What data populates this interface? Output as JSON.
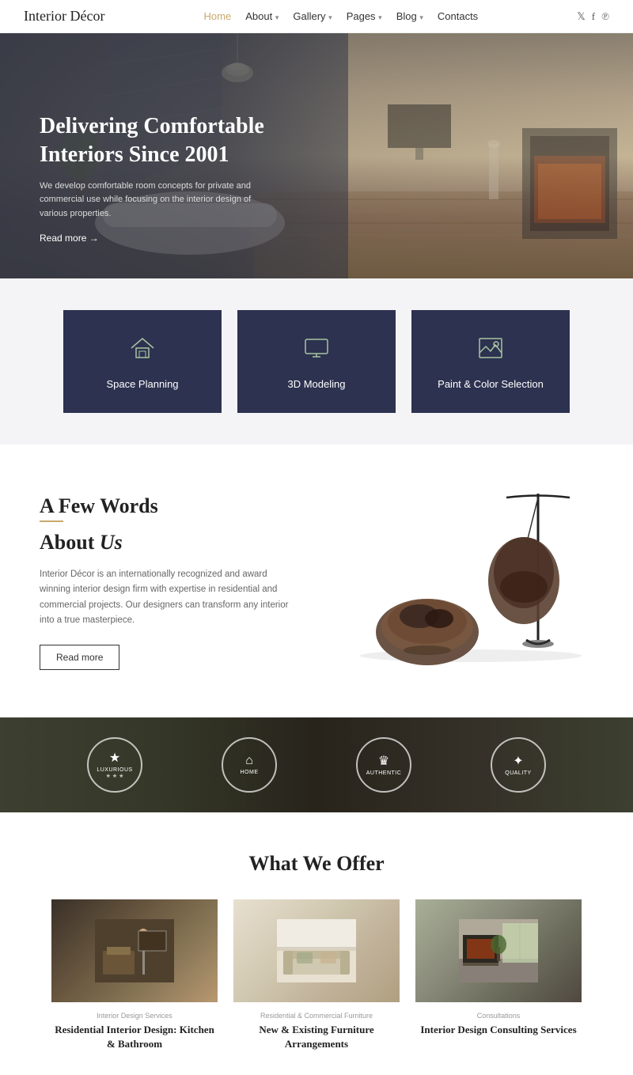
{
  "brand": {
    "name": "Interior Décor"
  },
  "nav": {
    "links": [
      {
        "label": "Home",
        "active": true
      },
      {
        "label": "About",
        "dropdown": true
      },
      {
        "label": "Gallery",
        "dropdown": true
      },
      {
        "label": "Pages",
        "dropdown": true
      },
      {
        "label": "Blog",
        "dropdown": true
      },
      {
        "label": "Contacts",
        "dropdown": false
      }
    ],
    "social": [
      "twitter",
      "facebook",
      "pinterest"
    ]
  },
  "hero": {
    "title": "Delivering Comfortable Interiors Since 2001",
    "description": "We develop comfortable room concepts for private and commercial use while focusing on the interior design of various properties.",
    "cta": "Read more"
  },
  "services": [
    {
      "label": "Space Planning",
      "icon": "🏠"
    },
    {
      "label": "3D Modeling",
      "icon": "🖥"
    },
    {
      "label": "Paint & Color Selection",
      "icon": "🖼"
    }
  ],
  "about": {
    "title_line1": "A Few Words",
    "title_line2": "About",
    "title_italic": "Us",
    "description": "Interior Décor is an internationally recognized and award winning interior design firm with expertise in residential and commercial projects. Our designers can transform any interior into a true masterpiece.",
    "cta": "Read more"
  },
  "badges": [
    {
      "icon": "★",
      "text": "Luxurious",
      "sub": "★ ★ ★"
    },
    {
      "icon": "⌂",
      "text": "Home"
    },
    {
      "icon": "♛",
      "text": "Authentic"
    },
    {
      "icon": "✦",
      "text": "Quality"
    }
  ],
  "offer": {
    "title": "What We Offer",
    "cards": [
      {
        "category": "Interior Design Services",
        "name": "Residential Interior Design: Kitchen & Bathroom",
        "type": "bathroom"
      },
      {
        "category": "Residential & Commercial Furniture",
        "name": "New & Existing Furniture Arrangements",
        "type": "living"
      },
      {
        "category": "Consultations",
        "name": "Interior Design Consulting Services",
        "type": "modern"
      }
    ]
  }
}
